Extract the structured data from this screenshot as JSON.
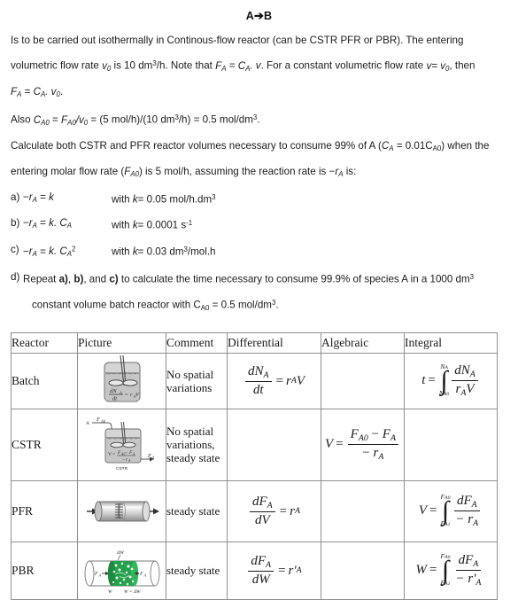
{
  "heading": {
    "reactant": "A",
    "arrow": "➔",
    "product": "B",
    "full": "A➔B"
  },
  "body": {
    "p1_part1": "Is to be carried out isothermally in Continous-flow reactor (can be CSTR PFR or PBR). The entering volumetric flow rate ",
    "p1_sym_v0": "v",
    "p1_sub_0": "0",
    "p1_part2": " is 10 dm",
    "p1_sup_3": "3",
    "p1_part3": "/h. Note that ",
    "p1_FA": "F",
    "p1_FA_sub": "A",
    "p1_eq": " = ",
    "p1_CA": "C",
    "p1_CA_sub": "A",
    "p1_dot_v": ". v",
    "p1_part4": ". For a constant volumetric flow rate ",
    "p1_veqv0": "v= v",
    "p1_part5": ", then",
    "p2": "F_A = C_A. v_0.",
    "p3_lead": "Also ",
    "p3_CA0": "C",
    "p3_CA0_sub": "A0",
    "p3_eq1": " = ",
    "p3_FA0": "F",
    "p3_FA0_sub": "A0",
    "p3_slash": "/v",
    "p3_v0_sub": "0",
    "p3_rest": " = (5 mol/h)/(10 dm",
    "p3_sup3a": "3",
    "p3_rest2": "/h) = 0.5 mol/dm",
    "p3_sup3b": "3",
    "p3_end": ".",
    "p4_a": "Calculate both CSTR and PFR reactor volumes necessary to consume 99% of A (",
    "p4_CA": "C",
    "p4_CA_sub": "A",
    "p4_val": " = 0.01C",
    "p4_val_sub": "A0",
    "p4_b": ") when the entering molar flow rate (",
    "p4_FA0": "F",
    "p4_FA0_sub": "A0",
    "p4_c": ") is 5 mol/h, assuming the reaction rate is −",
    "p4_rA": "r",
    "p4_rA_sub": "A",
    "p4_d": " is:"
  },
  "options": [
    {
      "label": "a)",
      "rate_minus": "−",
      "rate_r": "r",
      "rate_sub": "A",
      "rate_eq": " = ",
      "rate_expr": "k",
      "rate_expr_sub": "",
      "rate_expr_sup": "",
      "k_prefix": "with ",
      "k_sym": "k",
      "k_value": "= 0.05 mol/h.dm",
      "k_sup": "3"
    },
    {
      "label": "b)",
      "rate_minus": "−",
      "rate_r": "r",
      "rate_sub": "A",
      "rate_eq": " = ",
      "rate_expr": "k. C",
      "rate_expr_sub": "A",
      "rate_expr_sup": "",
      "k_prefix": "with ",
      "k_sym": "k",
      "k_value": "= 0.0001 s",
      "k_sup": "-1"
    },
    {
      "label": "c)",
      "rate_minus": "−",
      "rate_r": "r",
      "rate_sub": "A",
      "rate_eq": " = ",
      "rate_expr": "k. C",
      "rate_expr_sub": "A",
      "rate_expr_sup": "2",
      "k_prefix": "with ",
      "k_sym": "k",
      "k_value": "= 0.03 dm",
      "k_sup": "3",
      "k_tail": "/mol.h"
    }
  ],
  "option_d": {
    "label": "d)",
    "t1": "Repeat ",
    "ra": "a)",
    "t2": ", ",
    "rb": "b)",
    "t3": ", and ",
    "rc": "c)",
    "t4": " to calculate the time necessary to consume 99.9% of species A in a 1000 dm",
    "sup3": "3",
    "line2a": "constant volume batch reactor with C",
    "line2a_sub": "A0",
    "line2b": " = 0.5 mol/dm",
    "line2_sup3": "3",
    "line2_end": "."
  },
  "table": {
    "headers": [
      "Reactor",
      "Picture",
      "Comment",
      "Differential",
      "Algebraic",
      "Integral"
    ],
    "rows": [
      {
        "reactor": "Batch",
        "picture_name": "batch-reactor-diagram",
        "picture_caption": "dN_A/dt = r_A V",
        "comment": "No spatial variations",
        "differential": {
          "lhs_num": "dN",
          "lhs_num_sub": "A",
          "lhs_den": "dt",
          "rhs": "r",
          "rhs_sub": "A",
          "rhs_tail": "V"
        },
        "algebraic": "",
        "integral": {
          "lhs": "t",
          "upper": "N",
          "upper_sub": "A",
          "lower": "N",
          "lower_sub": "A0",
          "num": "dN",
          "num_sub": "A",
          "den": "r",
          "den_sub": "A",
          "den_tail": "V"
        }
      },
      {
        "reactor": "CSTR",
        "picture_name": "cstr-reactor-diagram",
        "picture_caption": "CSTR",
        "picture_in": "F_A0",
        "picture_out": "F_A",
        "comment": "No spatial variations, steady state",
        "differential": null,
        "algebraic": {
          "lhs": "V",
          "num_a": "F",
          "num_a_sub": "A0",
          "num_minus": " − ",
          "num_b": "F",
          "num_b_sub": "A",
          "den_minus": "− ",
          "den": "r",
          "den_sub": "A"
        },
        "integral": ""
      },
      {
        "reactor": "PFR",
        "picture_name": "pfr-reactor-diagram",
        "comment": "steady state",
        "differential": {
          "lhs_num": "dF",
          "lhs_num_sub": "A",
          "lhs_den": "dV",
          "rhs": "r",
          "rhs_sub": "A",
          "rhs_tail": ""
        },
        "algebraic": "",
        "integral": {
          "lhs": "V",
          "upper": "F",
          "upper_sub": "A0",
          "lower": "F",
          "lower_sub": "A1",
          "num": "dF",
          "num_sub": "A",
          "den": "− r",
          "den_sub": "A",
          "den_tail": ""
        }
      },
      {
        "reactor": "PBR",
        "picture_name": "pbr-reactor-diagram",
        "picture_top": "ΔW",
        "picture_left": "F_A",
        "picture_right": "F_A",
        "picture_bottom_left": "W",
        "picture_bottom_right": "W + ΔW",
        "comment": "steady state",
        "differential": {
          "lhs_num": "dF",
          "lhs_num_sub": "A",
          "lhs_den": "dW",
          "rhs": "r'",
          "rhs_sub": "A",
          "rhs_tail": ""
        },
        "algebraic": "",
        "integral": {
          "lhs": "W",
          "upper": "F",
          "upper_sub": "A0",
          "lower": "F",
          "lower_sub": "A1",
          "num": "dF",
          "num_sub": "A",
          "den": "− r'",
          "den_sub": "A",
          "den_tail": ""
        }
      }
    ]
  },
  "colors": {
    "text": "#1a1a1a",
    "table_border": "#8f8f8f",
    "catalyst_green": "#22a04a",
    "vessel_gray": "#c9c9c9",
    "page_background": "#ffffff"
  }
}
